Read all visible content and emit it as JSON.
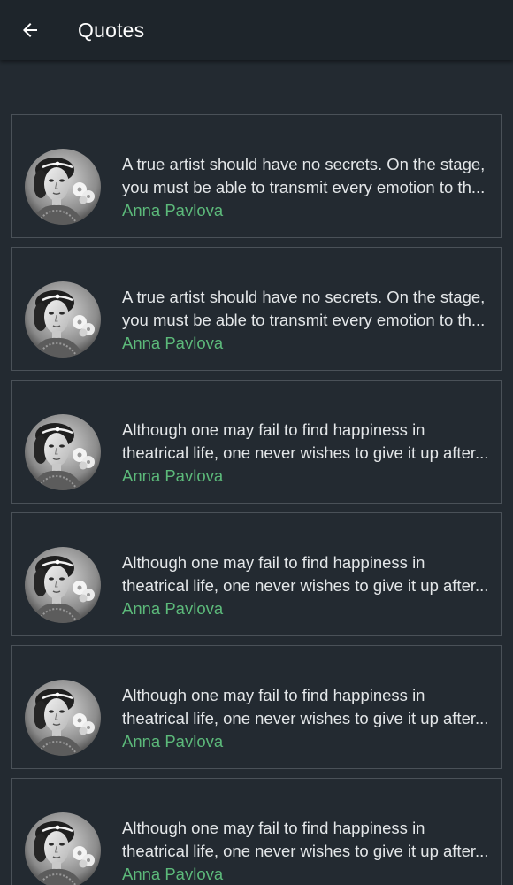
{
  "header": {
    "title": "Quotes",
    "back_icon": "arrow-back-icon"
  },
  "colors": {
    "background": "#232a31",
    "app_bar": "#1e252b",
    "card_border": "#4a5158",
    "text": "#e3e6e8",
    "author": "#5cb97a"
  },
  "quotes": [
    {
      "line1": "A true artist should have no secrets. On the stage,",
      "line2": "you must be able to transmit every emotion to th...",
      "author": "Anna Pavlova"
    },
    {
      "line1": "A true artist should have no secrets. On the stage,",
      "line2": "you must be able to transmit every emotion to th...",
      "author": "Anna Pavlova"
    },
    {
      "line1": "Although one may fail to find happiness in",
      "line2": "theatrical life, one never wishes to give it up after...",
      "author": "Anna Pavlova"
    },
    {
      "line1": "Although one may fail to find happiness in",
      "line2": "theatrical life, one never wishes to give it up after...",
      "author": "Anna Pavlova"
    },
    {
      "line1": "Although one may fail to find happiness in",
      "line2": "theatrical life, one never wishes to give it up after...",
      "author": "Anna Pavlova"
    },
    {
      "line1": "Although one may fail to find happiness in",
      "line2": "theatrical life, one never wishes to give it up after...",
      "author": "Anna Pavlova"
    }
  ]
}
